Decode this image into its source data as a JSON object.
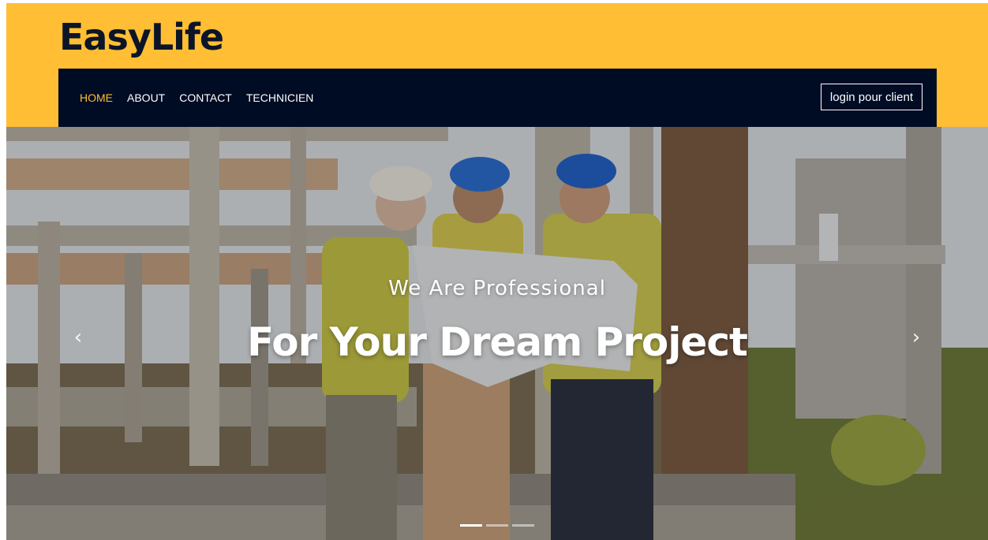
{
  "brand": {
    "name": "EasyLife"
  },
  "nav": {
    "items": [
      {
        "label": "HOME",
        "active": true
      },
      {
        "label": "ABOUT",
        "active": false
      },
      {
        "label": "CONTACT",
        "active": false
      },
      {
        "label": "TECHNICIEN",
        "active": false
      }
    ],
    "login_label": "login pour client"
  },
  "hero": {
    "subtitle": "We Are Professional",
    "title": "For Your Dream Project",
    "prev_icon": "chevron-left-icon",
    "next_icon": "chevron-right-icon",
    "slides_count": 3,
    "active_slide": 1
  },
  "colors": {
    "header_bg": "#ffbe33",
    "navbar_bg": "#000b24",
    "active_link": "#ffbe33",
    "brand_text": "#0c1528"
  }
}
